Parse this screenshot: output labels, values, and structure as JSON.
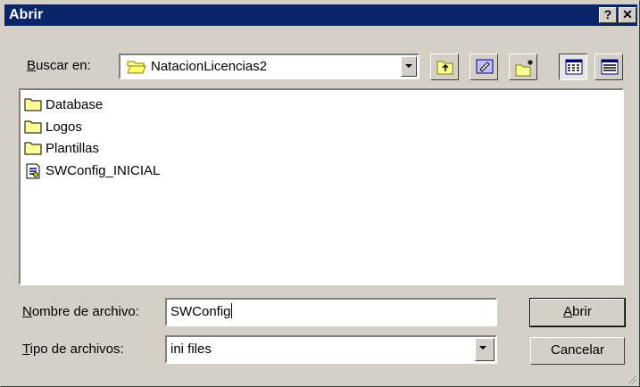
{
  "window": {
    "title": "Abrir",
    "help_label": "?",
    "close_label": "✕"
  },
  "lookin": {
    "label_ul": "B",
    "label_rest": "uscar en:",
    "value": "NatacionLicencias2"
  },
  "toolbar": [
    "up-one-level",
    "desktop",
    "new-folder",
    "list-view",
    "details-view"
  ],
  "files": [
    {
      "name": "Database",
      "type": "folder"
    },
    {
      "name": "Logos",
      "type": "folder"
    },
    {
      "name": "Plantillas",
      "type": "folder"
    },
    {
      "name": "SWConfig_INICIAL",
      "type": "config-file"
    }
  ],
  "filename": {
    "label_ul": "N",
    "label_rest": "ombre de archivo:",
    "value": "SWConfig"
  },
  "filetype": {
    "label_ul": "T",
    "label_rest": "ipo de archivos:",
    "value": "ini files"
  },
  "buttons": {
    "open_ul": "A",
    "open_rest": "brir",
    "cancel": "Cancelar"
  }
}
